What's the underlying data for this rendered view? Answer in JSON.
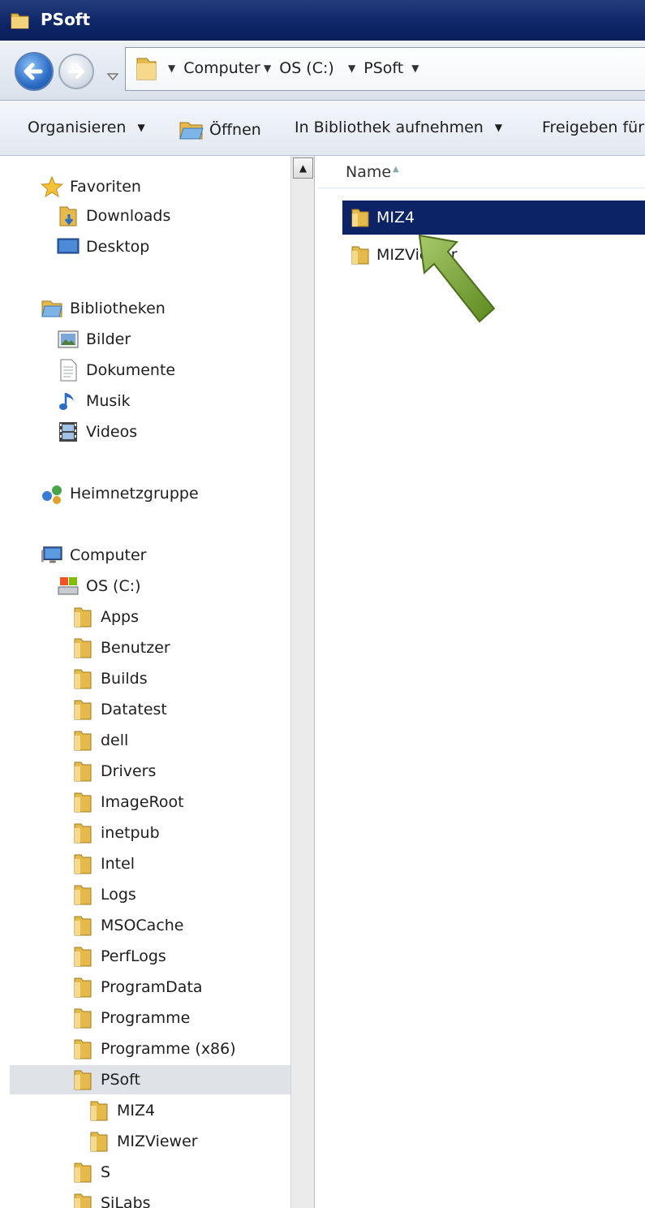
{
  "window": {
    "title": "PSoft"
  },
  "address": {
    "crumbs": [
      "Computer",
      "OS (C:)",
      "PSoft"
    ]
  },
  "commands": {
    "organize": "Organisieren",
    "open": "Öffnen",
    "library": "In Bibliothek aufnehmen",
    "share": "Freigeben für"
  },
  "nav": {
    "favorites": "Favoriten",
    "downloads": "Downloads",
    "desktop": "Desktop",
    "libraries": "Bibliotheken",
    "pictures": "Bilder",
    "documents": "Dokumente",
    "music": "Musik",
    "videos": "Videos",
    "homegroup": "Heimnetzgruppe",
    "computer": "Computer",
    "drive": "OS (C:)",
    "folders": [
      "Apps",
      "Benutzer",
      "Builds",
      "Datatest",
      "dell",
      "Drivers",
      "ImageRoot",
      "inetpub",
      "Intel",
      "Logs",
      "MSOCache",
      "PerfLogs",
      "ProgramData",
      "Programme",
      "Programme (x86)",
      "PSoft"
    ],
    "psoft_children": [
      "MIZ4",
      "MIZViewer"
    ],
    "after": [
      "S",
      "SiLabs"
    ]
  },
  "content": {
    "column_name": "Name",
    "files": [
      "MIZ4",
      "MIZViewer"
    ],
    "selected_index": 0
  },
  "colors": {
    "selection": "#0c2466",
    "arrow": "#6f9a2e"
  }
}
